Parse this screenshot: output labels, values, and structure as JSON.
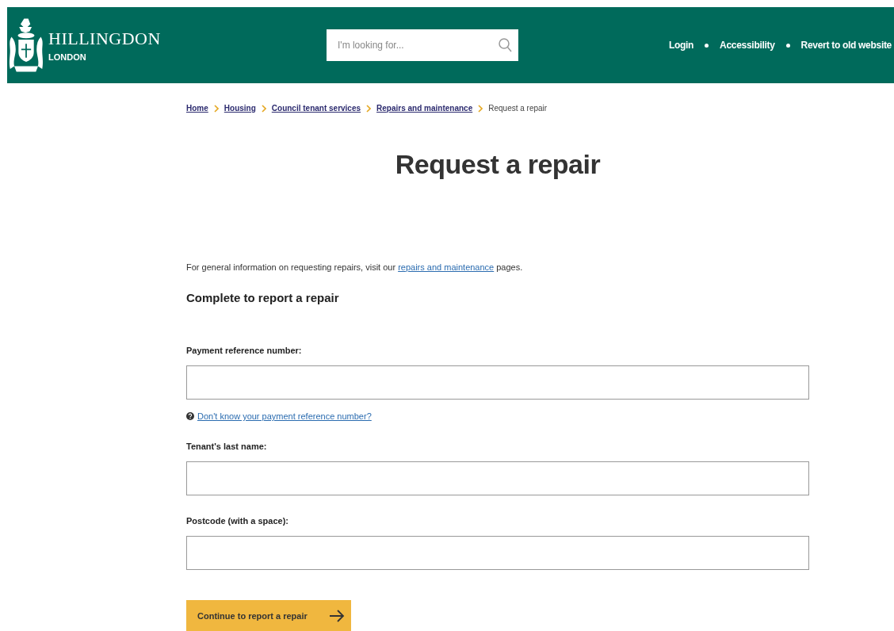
{
  "header": {
    "logo_name": "HILLINGDON",
    "logo_sub": "LONDON",
    "search": {
      "placeholder": "I'm looking for..."
    },
    "links": [
      "Login",
      "Accessibility",
      "Revert to old website"
    ]
  },
  "breadcrumb": {
    "links": [
      "Home",
      "Housing",
      "Council tenant services",
      "Repairs and maintenance"
    ],
    "current": "Request a repair"
  },
  "title": "Request a repair",
  "intro": {
    "before": "For general information on requesting repairs, visit our",
    "link": "repairs and maintenance",
    "after": "pages."
  },
  "form_heading": "Complete to report a repair",
  "fields": [
    {
      "label": "Payment reference number:",
      "help_link": "Don't know your payment reference number?"
    },
    {
      "label": "Tenant's last name:"
    },
    {
      "label": "Postcode (with a space):"
    }
  ],
  "submit": "Continue to report a repair"
}
